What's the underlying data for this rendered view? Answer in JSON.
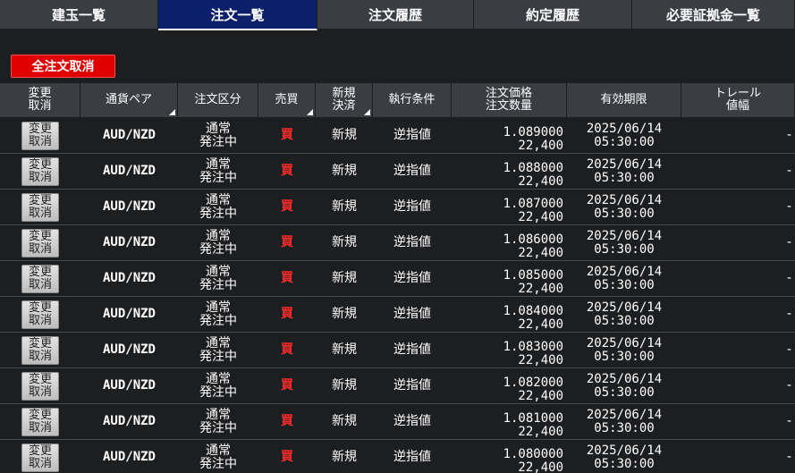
{
  "tabs": [
    {
      "label": "建玉一覧",
      "active": false
    },
    {
      "label": "注文一覧",
      "active": true
    },
    {
      "label": "注文履歴",
      "active": false
    },
    {
      "label": "約定履歴",
      "active": false
    },
    {
      "label": "必要証拠金一覧",
      "active": false
    }
  ],
  "cancel_all_label": "全注文取消",
  "columns": [
    {
      "label": "変更\n取消",
      "sortable": false
    },
    {
      "label": "通貨ペア",
      "sortable": true
    },
    {
      "label": "注文区分",
      "sortable": false
    },
    {
      "label": "売買",
      "sortable": true
    },
    {
      "label": "新規\n決済",
      "sortable": true
    },
    {
      "label": "執行条件",
      "sortable": false
    },
    {
      "label": "注文価格\n注文数量",
      "sortable": false
    },
    {
      "label": "有効期限",
      "sortable": false
    },
    {
      "label": "トレール\n値幅",
      "sortable": false
    }
  ],
  "rows": [
    {
      "action": "変更\n取消",
      "pair": "AUD/NZD",
      "order_type": "通常\n発注中",
      "side": "買",
      "open_close": "新規",
      "condition": "逆指値",
      "price": "1.089000",
      "qty": "22,400",
      "expiry_date": "2025/06/14",
      "expiry_time": "05:30:00",
      "trail": "-"
    },
    {
      "action": "変更\n取消",
      "pair": "AUD/NZD",
      "order_type": "通常\n発注中",
      "side": "買",
      "open_close": "新規",
      "condition": "逆指値",
      "price": "1.088000",
      "qty": "22,400",
      "expiry_date": "2025/06/14",
      "expiry_time": "05:30:00",
      "trail": "-"
    },
    {
      "action": "変更\n取消",
      "pair": "AUD/NZD",
      "order_type": "通常\n発注中",
      "side": "買",
      "open_close": "新規",
      "condition": "逆指値",
      "price": "1.087000",
      "qty": "22,400",
      "expiry_date": "2025/06/14",
      "expiry_time": "05:30:00",
      "trail": "-"
    },
    {
      "action": "変更\n取消",
      "pair": "AUD/NZD",
      "order_type": "通常\n発注中",
      "side": "買",
      "open_close": "新規",
      "condition": "逆指値",
      "price": "1.086000",
      "qty": "22,400",
      "expiry_date": "2025/06/14",
      "expiry_time": "05:30:00",
      "trail": "-"
    },
    {
      "action": "変更\n取消",
      "pair": "AUD/NZD",
      "order_type": "通常\n発注中",
      "side": "買",
      "open_close": "新規",
      "condition": "逆指値",
      "price": "1.085000",
      "qty": "22,400",
      "expiry_date": "2025/06/14",
      "expiry_time": "05:30:00",
      "trail": "-"
    },
    {
      "action": "変更\n取消",
      "pair": "AUD/NZD",
      "order_type": "通常\n発注中",
      "side": "買",
      "open_close": "新規",
      "condition": "逆指値",
      "price": "1.084000",
      "qty": "22,400",
      "expiry_date": "2025/06/14",
      "expiry_time": "05:30:00",
      "trail": "-"
    },
    {
      "action": "変更\n取消",
      "pair": "AUD/NZD",
      "order_type": "通常\n発注中",
      "side": "買",
      "open_close": "新規",
      "condition": "逆指値",
      "price": "1.083000",
      "qty": "22,400",
      "expiry_date": "2025/06/14",
      "expiry_time": "05:30:00",
      "trail": "-"
    },
    {
      "action": "変更\n取消",
      "pair": "AUD/NZD",
      "order_type": "通常\n発注中",
      "side": "買",
      "open_close": "新規",
      "condition": "逆指値",
      "price": "1.082000",
      "qty": "22,400",
      "expiry_date": "2025/06/14",
      "expiry_time": "05:30:00",
      "trail": "-"
    },
    {
      "action": "変更\n取消",
      "pair": "AUD/NZD",
      "order_type": "通常\n発注中",
      "side": "買",
      "open_close": "新規",
      "condition": "逆指値",
      "price": "1.081000",
      "qty": "22,400",
      "expiry_date": "2025/06/14",
      "expiry_time": "05:30:00",
      "trail": "-"
    },
    {
      "action": "変更\n取消",
      "pair": "AUD/NZD",
      "order_type": "通常\n発注中",
      "side": "買",
      "open_close": "新規",
      "condition": "逆指値",
      "price": "1.080000",
      "qty": "22,400",
      "expiry_date": "2025/06/14",
      "expiry_time": "05:30:00",
      "trail": "-"
    }
  ]
}
